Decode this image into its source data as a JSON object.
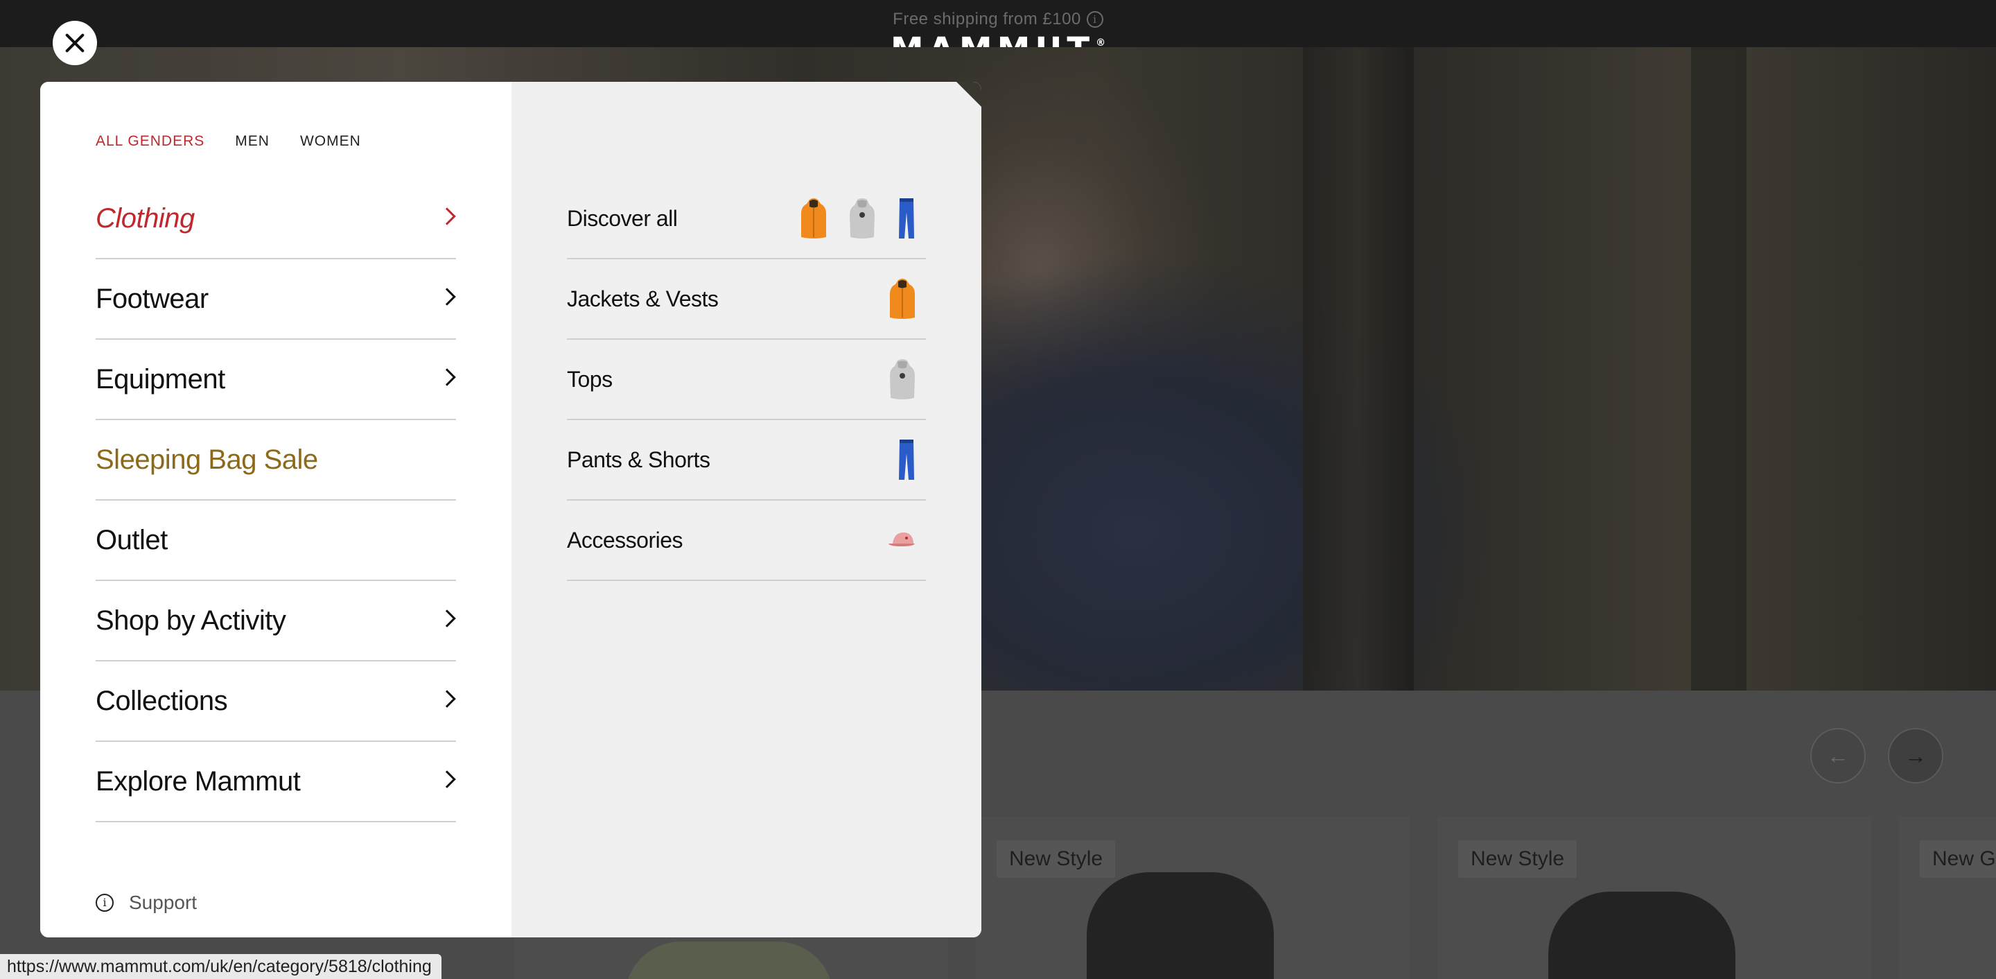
{
  "topbar": {
    "shipping_text": "Free shipping from £100",
    "info_glyph": "i",
    "logo_text": "MAMMUT",
    "logo_mark": "®"
  },
  "menu": {
    "genders": [
      {
        "label": "ALL GENDERS",
        "active": true
      },
      {
        "label": "MEN",
        "active": false
      },
      {
        "label": "WOMEN",
        "active": false
      }
    ],
    "categories": [
      {
        "label": "Clothing",
        "has_arrow": true,
        "state": "active"
      },
      {
        "label": "Footwear",
        "has_arrow": true,
        "state": "normal"
      },
      {
        "label": "Equipment",
        "has_arrow": true,
        "state": "normal"
      },
      {
        "label": "Sleeping Bag Sale",
        "has_arrow": false,
        "state": "sale"
      },
      {
        "label": "Outlet",
        "has_arrow": false,
        "state": "normal"
      },
      {
        "label": "Shop by Activity",
        "has_arrow": true,
        "state": "normal"
      },
      {
        "label": "Collections",
        "has_arrow": true,
        "state": "normal"
      },
      {
        "label": "Explore Mammut",
        "has_arrow": true,
        "state": "normal"
      }
    ],
    "subcategories": [
      {
        "label": "Discover all",
        "thumbs": [
          "orange-jacket-icon",
          "grey-hoodie-icon",
          "blue-pants-icon"
        ]
      },
      {
        "label": "Jackets & Vests",
        "thumbs": [
          "orange-jacket-icon"
        ]
      },
      {
        "label": "Tops",
        "thumbs": [
          "grey-hoodie-icon"
        ]
      },
      {
        "label": "Pants & Shorts",
        "thumbs": [
          "blue-pants-icon"
        ]
      },
      {
        "label": "Accessories",
        "thumbs": [
          "pink-cap-icon"
        ]
      }
    ],
    "support_label": "Support",
    "support_glyph": "i"
  },
  "products": {
    "badges": [
      "New Style",
      "New Style",
      "New G"
    ]
  },
  "statusbar_url": "https://www.mammut.com/uk/en/category/5818/clothing",
  "colors": {
    "accent_red": "#c0282d",
    "sale_gold": "#8d6a1a",
    "jacket_orange": "#f08a1c",
    "pants_blue": "#2a5bc8",
    "hoodie_grey": "#c8c8c8"
  }
}
